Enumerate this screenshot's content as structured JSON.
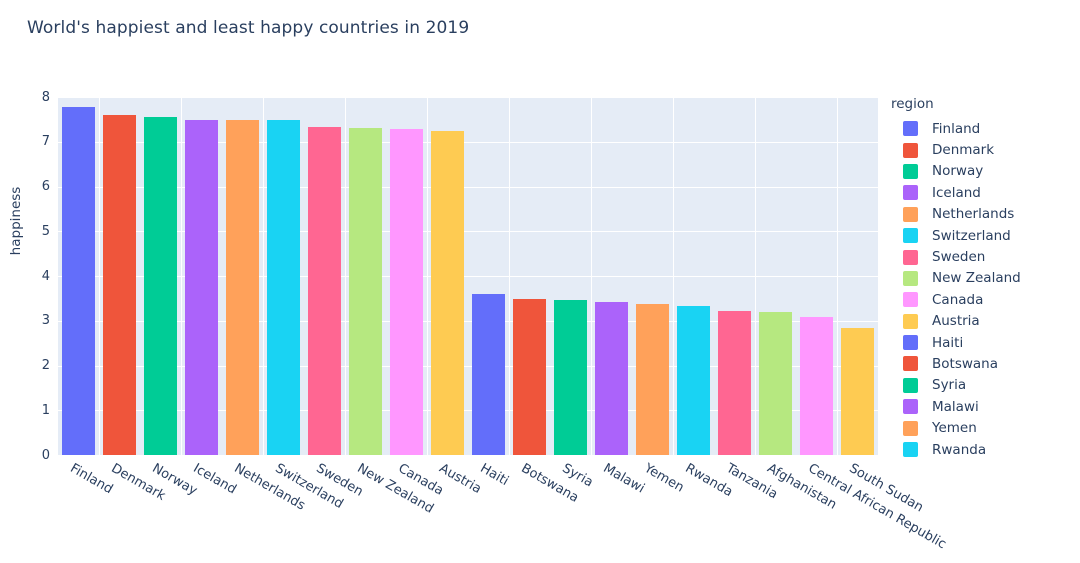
{
  "chart_data": {
    "type": "bar",
    "title": "World's happiest and least happy countries in 2019",
    "xlabel": "",
    "ylabel": "happiness",
    "ylim": [
      0,
      8
    ],
    "ytick_labels": [
      "0",
      "1",
      "2",
      "3",
      "4",
      "5",
      "6",
      "7",
      "8"
    ],
    "grid": true,
    "legend_position": "right",
    "legend_title": "region",
    "categories": [
      "Finland",
      "Denmark",
      "Norway",
      "Iceland",
      "Netherlands",
      "Switzerland",
      "Sweden",
      "New Zealand",
      "Canada",
      "Austria",
      "Haiti",
      "Botswana",
      "Syria",
      "Malawi",
      "Yemen",
      "Rwanda",
      "Tanzania",
      "Afghanistan",
      "Central African Republic",
      "South Sudan"
    ],
    "values": [
      7.77,
      7.6,
      7.55,
      7.49,
      7.49,
      7.48,
      7.34,
      7.31,
      7.28,
      7.25,
      3.6,
      3.49,
      3.46,
      3.41,
      3.38,
      3.33,
      3.23,
      3.2,
      3.08,
      2.85
    ],
    "colors": [
      "#636efa",
      "#ef553b",
      "#00cc96",
      "#ab63fa",
      "#ffa15a",
      "#19d3f3",
      "#ff6692",
      "#b6e880",
      "#ff97ff",
      "#fecb52",
      "#636efa",
      "#ef553b",
      "#00cc96",
      "#ab63fa",
      "#ffa15a",
      "#19d3f3",
      "#ff6692",
      "#b6e880",
      "#ff97ff",
      "#fecb52"
    ],
    "plot_bgcolor": "#E5ECF6",
    "paper_bgcolor": "#ffffff",
    "font_color": "#2a3f5f"
  },
  "legend": {
    "title": "region",
    "entries": [
      {
        "label": "Finland",
        "color": "#636efa"
      },
      {
        "label": "Denmark",
        "color": "#ef553b"
      },
      {
        "label": "Norway",
        "color": "#00cc96"
      },
      {
        "label": "Iceland",
        "color": "#ab63fa"
      },
      {
        "label": "Netherlands",
        "color": "#ffa15a"
      },
      {
        "label": "Switzerland",
        "color": "#19d3f3"
      },
      {
        "label": "Sweden",
        "color": "#ff6692"
      },
      {
        "label": "New Zealand",
        "color": "#b6e880"
      },
      {
        "label": "Canada",
        "color": "#ff97ff"
      },
      {
        "label": "Austria",
        "color": "#fecb52"
      },
      {
        "label": "Haiti",
        "color": "#636efa"
      },
      {
        "label": "Botswana",
        "color": "#ef553b"
      },
      {
        "label": "Syria",
        "color": "#00cc96"
      },
      {
        "label": "Malawi",
        "color": "#ab63fa"
      },
      {
        "label": "Yemen",
        "color": "#ffa15a"
      },
      {
        "label": "Rwanda",
        "color": "#19d3f3"
      }
    ]
  }
}
